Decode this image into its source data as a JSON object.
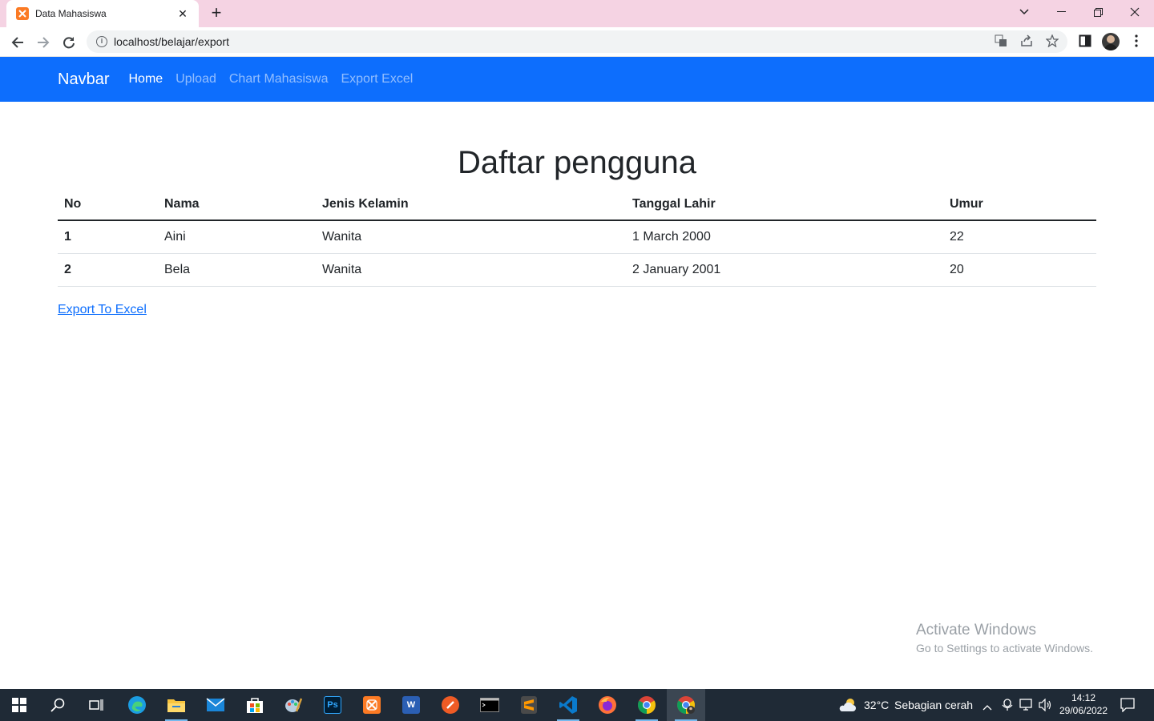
{
  "browser": {
    "tab_title": "Data Mahasiswa",
    "url": "localhost/belajar/export",
    "new_tab_symbol": "+",
    "tab_close_symbol": "✕"
  },
  "navbar": {
    "brand": "Navbar",
    "links": [
      {
        "label": "Home",
        "active": true
      },
      {
        "label": "Upload",
        "active": false
      },
      {
        "label": "Chart Mahasiswa",
        "active": false
      },
      {
        "label": "Export Excel",
        "active": false
      }
    ],
    "background_color": "#0d6efd"
  },
  "main": {
    "title": "Daftar pengguna",
    "table": {
      "headers": [
        "No",
        "Nama",
        "Jenis Kelamin",
        "Tanggal Lahir",
        "Umur"
      ],
      "rows": [
        [
          "1",
          "Aini",
          "Wanita",
          "1 March 2000",
          "22"
        ],
        [
          "2",
          "Bela",
          "Wanita",
          "2 January 2001",
          "20"
        ]
      ]
    },
    "export_link": "Export To Excel"
  },
  "watermark": {
    "line1": "Activate Windows",
    "line2": "Go to Settings to activate Windows."
  },
  "taskbar": {
    "weather_temp": "32°C",
    "weather_desc": "Sebagian cerah",
    "time": "14:12",
    "date": "29/06/2022",
    "apps": [
      "windows-start-icon",
      "search-icon",
      "task-view-icon",
      "edge-icon",
      "file-explorer-icon",
      "mail-icon",
      "store-icon",
      "paint-icon",
      "photoshop-icon",
      "xampp-icon",
      "word-icon",
      "postman-icon",
      "terminal-icon",
      "sublime-icon",
      "vscode-icon",
      "firefox-icon",
      "chrome-icon",
      "chrome-profile-icon"
    ]
  }
}
